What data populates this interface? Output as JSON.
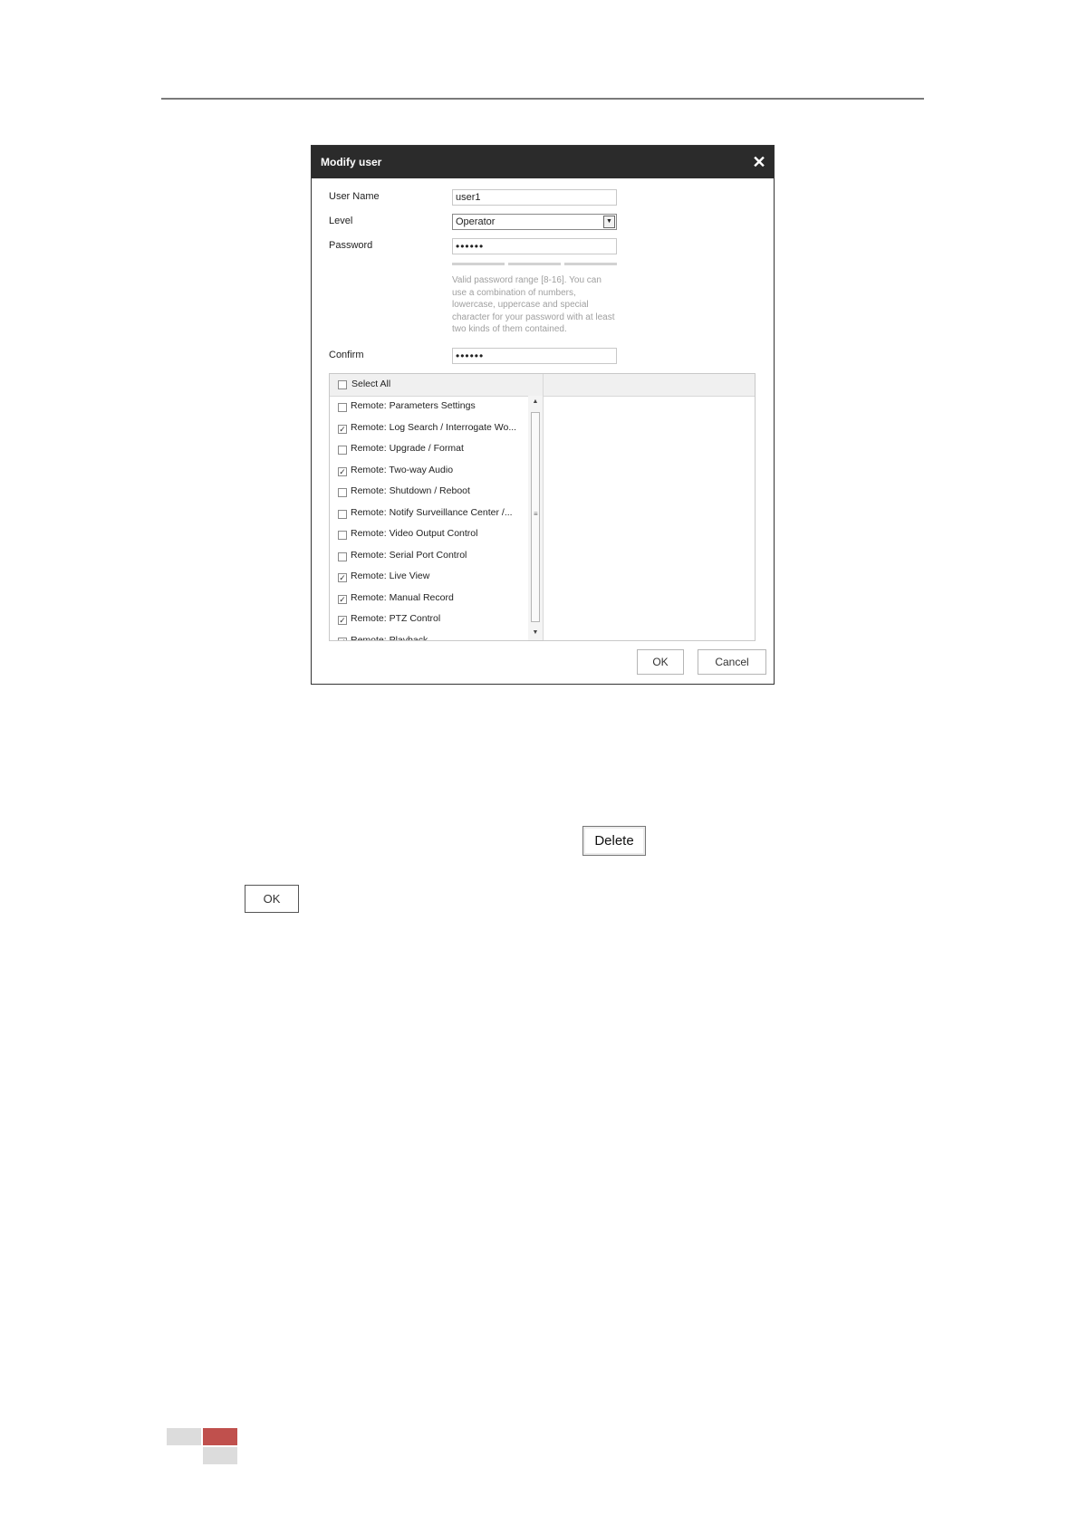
{
  "dialog": {
    "title": "Modify user",
    "close_symbol": "✕",
    "fields": {
      "user_name_label": "User Name",
      "user_name_value": "user1",
      "level_label": "Level",
      "level_value": "Operator",
      "password_label": "Password",
      "password_value": "••••••",
      "password_hint": "Valid password range [8-16]. You can use a combination of numbers, lowercase, uppercase and special character for your password with at least two kinds of them contained.",
      "confirm_label": "Confirm",
      "confirm_value": "••••••"
    },
    "permissions": {
      "select_all_label": "Select All",
      "items": [
        {
          "label": "Remote: Parameters Settings",
          "checked": false
        },
        {
          "label": "Remote: Log Search / Interrogate Wo...",
          "checked": true
        },
        {
          "label": "Remote: Upgrade / Format",
          "checked": false
        },
        {
          "label": "Remote: Two-way Audio",
          "checked": true
        },
        {
          "label": "Remote: Shutdown / Reboot",
          "checked": false
        },
        {
          "label": "Remote: Notify Surveillance Center /...",
          "checked": false
        },
        {
          "label": "Remote: Video Output Control",
          "checked": false
        },
        {
          "label": "Remote: Serial Port Control",
          "checked": false
        },
        {
          "label": "Remote: Live View",
          "checked": true
        },
        {
          "label": "Remote: Manual Record",
          "checked": true
        },
        {
          "label": "Remote: PTZ Control",
          "checked": true
        },
        {
          "label": "Remote: Playback",
          "checked": true
        }
      ]
    },
    "ok_label": "OK",
    "cancel_label": "Cancel"
  },
  "document": {
    "delete_button_label": "Delete",
    "ok_button_label": "OK"
  },
  "footer": {
    "colors": {
      "gray": "#dcdcdc",
      "red": "#c0504d"
    }
  }
}
